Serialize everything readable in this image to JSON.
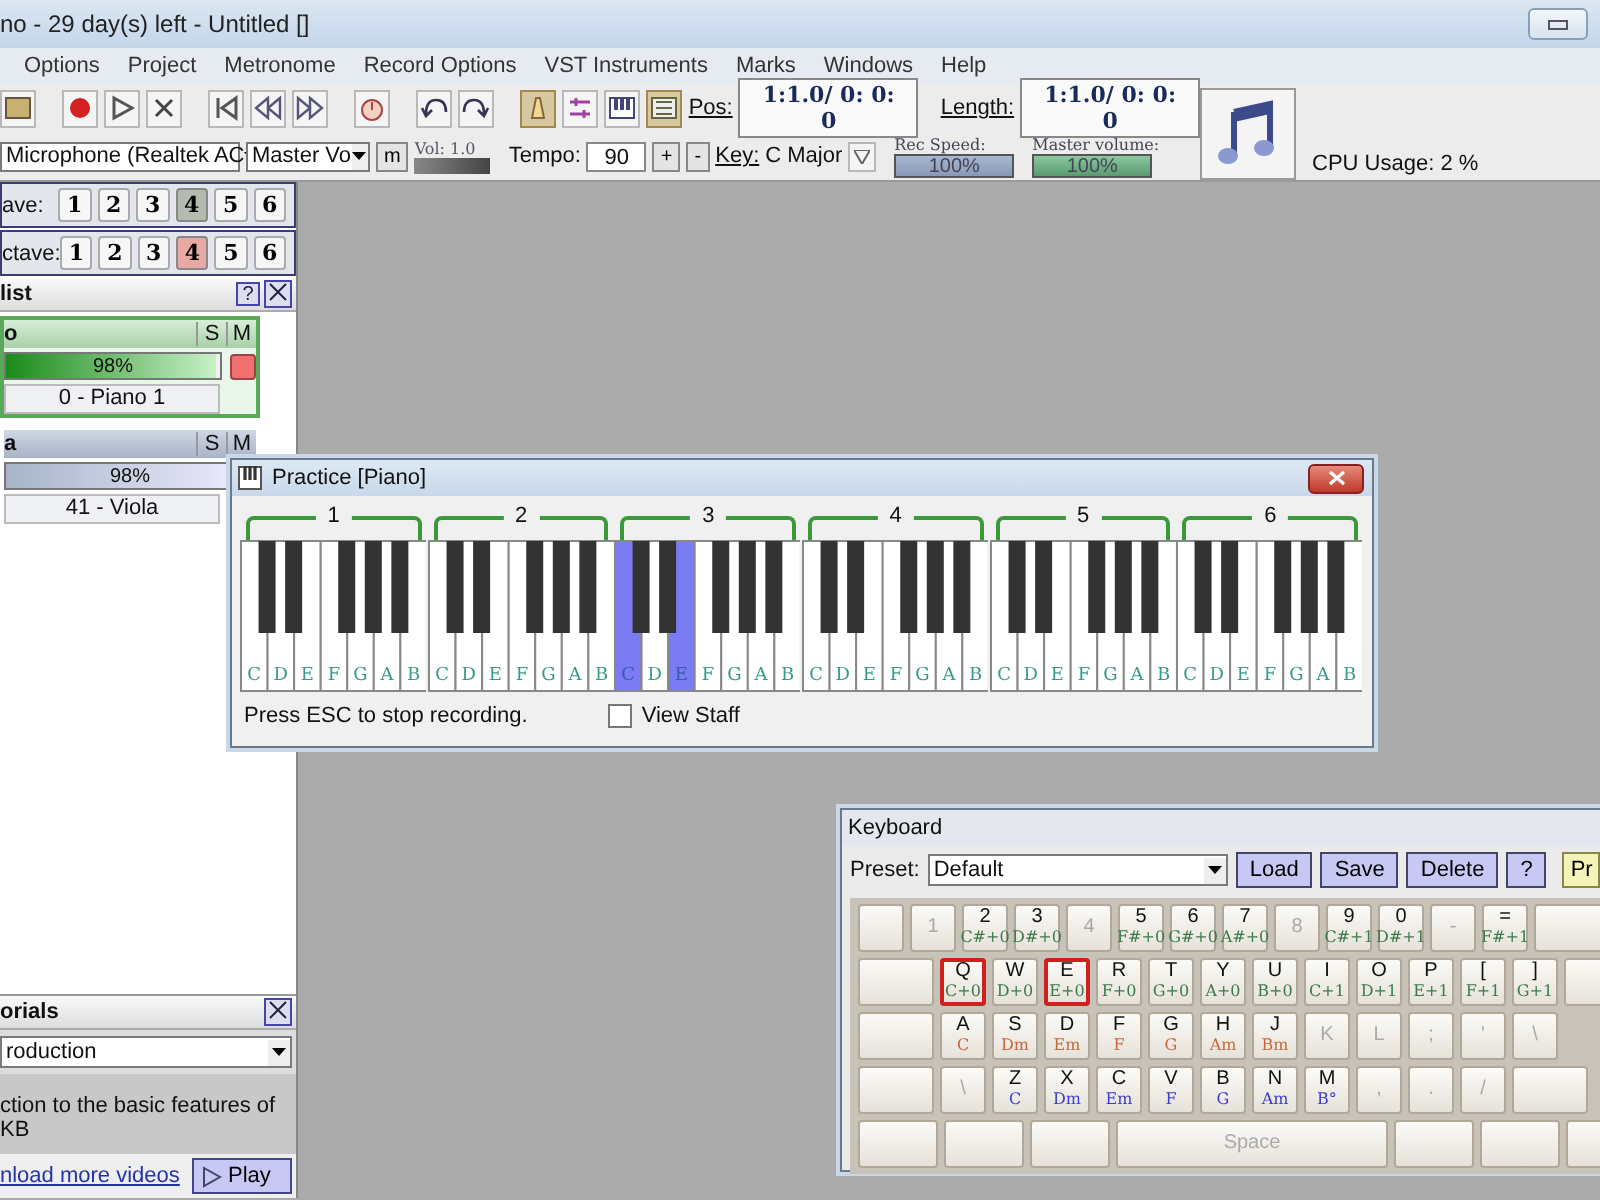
{
  "window": {
    "title": "no - 29 day(s) left - Untitled []"
  },
  "menu": [
    "Options",
    "Project",
    "Metronome",
    "Record Options",
    "VST Instruments",
    "Marks",
    "Windows",
    "Help"
  ],
  "transport": {
    "pos_label": "Pos:",
    "pos": "1:1.0/ 0: 0: 0",
    "length_label": "Length:",
    "length": "1:1.0/ 0: 0: 0"
  },
  "controls": {
    "input": "Microphone (Realtek AC",
    "output": "Master Vo",
    "mute": "m",
    "volume": {
      "label": "Vol: 1.0",
      "level": 1
    },
    "tempo_label": "Tempo:",
    "tempo": "90",
    "plus": "+",
    "minus": "-",
    "key_label": "Key:",
    "key": "C Major",
    "rec_speed_label": "Rec Speed:",
    "rec_speed": "100%",
    "master_label": "Master volume:",
    "master": "100%",
    "cpu": "CPU Usage: 2 %"
  },
  "octaves": [
    {
      "label": "ave:",
      "color": "#b4bcb0",
      "buttons": [
        {
          "label": "1",
          "selected": false
        },
        {
          "label": "2",
          "selected": false
        },
        {
          "label": "3",
          "selected": false
        },
        {
          "label": "4",
          "selected": true
        },
        {
          "label": "5",
          "selected": false
        },
        {
          "label": "6",
          "selected": false
        }
      ]
    },
    {
      "label": "ctave:",
      "color": "#e8a8a4",
      "buttons": [
        {
          "label": "1",
          "selected": false
        },
        {
          "label": "2",
          "selected": false
        },
        {
          "label": "3",
          "selected": false
        },
        {
          "label": "4",
          "selected": true
        },
        {
          "label": "5",
          "selected": false
        },
        {
          "label": "6",
          "selected": false
        }
      ]
    }
  ],
  "track_list": {
    "title": "list",
    "help": "?",
    "tracks": [
      {
        "name": "o",
        "solo": "S",
        "mute": "M",
        "level": 0.98,
        "reading": "98%",
        "instrument": "0 - Piano 1",
        "selected": true,
        "recording": true
      },
      {
        "name": "a",
        "solo": "S",
        "mute": "M",
        "level": 0.98,
        "reading": "98%",
        "instrument": "41 - Viola",
        "selected": false,
        "recording": false
      }
    ]
  },
  "tutorials": {
    "title": "orials",
    "video": "roduction",
    "description": "ction to the basic features of KB",
    "link": "nload more videos",
    "play": "Play"
  },
  "practice": {
    "title": "Practice [Piano]",
    "status": "Press ESC to stop recording.",
    "view_staff": {
      "label": "View Staff",
      "checked": false
    },
    "octaves": [
      {
        "label": "1",
        "keys": [
          {
            "note": "C",
            "pressed": false
          },
          {
            "note": "D",
            "pressed": false
          },
          {
            "note": "E",
            "pressed": false
          },
          {
            "note": "F",
            "pressed": false
          },
          {
            "note": "G",
            "pressed": false
          },
          {
            "note": "A",
            "pressed": false
          },
          {
            "note": "B",
            "pressed": false
          }
        ]
      },
      {
        "label": "2",
        "keys": [
          {
            "note": "C",
            "pressed": false
          },
          {
            "note": "D",
            "pressed": false
          },
          {
            "note": "E",
            "pressed": false
          },
          {
            "note": "F",
            "pressed": false
          },
          {
            "note": "G",
            "pressed": false
          },
          {
            "note": "A",
            "pressed": false
          },
          {
            "note": "B",
            "pressed": false
          }
        ]
      },
      {
        "label": "3",
        "keys": [
          {
            "note": "C",
            "pressed": true
          },
          {
            "note": "D",
            "pressed": false
          },
          {
            "note": "E",
            "pressed": true
          },
          {
            "note": "F",
            "pressed": false
          },
          {
            "note": "G",
            "pressed": false
          },
          {
            "note": "A",
            "pressed": false
          },
          {
            "note": "B",
            "pressed": false
          }
        ]
      },
      {
        "label": "4",
        "keys": [
          {
            "note": "C",
            "pressed": false
          },
          {
            "note": "D",
            "pressed": false
          },
          {
            "note": "E",
            "pressed": false
          },
          {
            "note": "F",
            "pressed": false
          },
          {
            "note": "G",
            "pressed": false
          },
          {
            "note": "A",
            "pressed": false
          },
          {
            "note": "B",
            "pressed": false
          }
        ]
      },
      {
        "label": "5",
        "keys": [
          {
            "note": "C",
            "pressed": false
          },
          {
            "note": "D",
            "pressed": false
          },
          {
            "note": "E",
            "pressed": false
          },
          {
            "note": "F",
            "pressed": false
          },
          {
            "note": "G",
            "pressed": false
          },
          {
            "note": "A",
            "pressed": false
          },
          {
            "note": "B",
            "pressed": false
          }
        ]
      },
      {
        "label": "6",
        "keys": [
          {
            "note": "C",
            "pressed": false
          },
          {
            "note": "D",
            "pressed": false
          },
          {
            "note": "E",
            "pressed": false
          },
          {
            "note": "F",
            "pressed": false
          },
          {
            "note": "G",
            "pressed": false
          },
          {
            "note": "A",
            "pressed": false
          },
          {
            "note": "B",
            "pressed": false
          }
        ]
      }
    ]
  },
  "keyboard": {
    "title": "Keyboard",
    "preset_label": "Preset:",
    "preset": "Default",
    "buttons": [
      "Load",
      "Save",
      "Delete",
      "?"
    ],
    "extra_button": "Pr",
    "rows": [
      {
        "color": "#3a7a4a",
        "keys": [
          {
            "kind": "blank",
            "pressed": false
          },
          {
            "kind": "key",
            "label": "1",
            "pressed": false
          },
          {
            "kind": "key",
            "label": "2",
            "note": "C#+0",
            "pressed": false
          },
          {
            "kind": "key",
            "label": "3",
            "note": "D#+0",
            "pressed": false
          },
          {
            "kind": "key",
            "label": "4",
            "pressed": false
          },
          {
            "kind": "key",
            "label": "5",
            "note": "F#+0",
            "pressed": false
          },
          {
            "kind": "key",
            "label": "6",
            "note": "G#+0",
            "pressed": false
          },
          {
            "kind": "key",
            "label": "7",
            "note": "A#+0",
            "pressed": false
          },
          {
            "kind": "key",
            "label": "8",
            "pressed": false
          },
          {
            "kind": "key",
            "label": "9",
            "note": "C#+1",
            "pressed": false
          },
          {
            "kind": "key",
            "label": "0",
            "note": "D#+1",
            "pressed": false
          },
          {
            "kind": "key",
            "label": "-",
            "pressed": false
          },
          {
            "kind": "key",
            "label": "=",
            "note": "F#+1",
            "pressed": false
          },
          {
            "kind": "wide",
            "pressed": false
          }
        ]
      },
      {
        "color": "#3a7a4a",
        "keys": [
          {
            "kind": "wide",
            "pressed": false
          },
          {
            "kind": "key",
            "label": "Q",
            "note": "C+0",
            "pressed": true
          },
          {
            "kind": "key",
            "label": "W",
            "note": "D+0",
            "pressed": false
          },
          {
            "kind": "key",
            "label": "E",
            "note": "E+0",
            "pressed": true
          },
          {
            "kind": "key",
            "label": "R",
            "note": "F+0",
            "pressed": false
          },
          {
            "kind": "key",
            "label": "T",
            "note": "G+0",
            "pressed": false
          },
          {
            "kind": "key",
            "label": "Y",
            "note": "A+0",
            "pressed": false
          },
          {
            "kind": "key",
            "label": "U",
            "note": "B+0",
            "pressed": false
          },
          {
            "kind": "key",
            "label": "I",
            "note": "C+1",
            "pressed": false
          },
          {
            "kind": "key",
            "label": "O",
            "note": "D+1",
            "pressed": false
          },
          {
            "kind": "key",
            "label": "P",
            "note": "E+1",
            "pressed": false
          },
          {
            "kind": "key",
            "label": "[",
            "note": "F+1",
            "pressed": false
          },
          {
            "kind": "key",
            "label": "]",
            "note": "G+1",
            "pressed": false
          },
          {
            "kind": "wide",
            "pressed": false
          }
        ]
      },
      {
        "color": "#c8683a",
        "keys": [
          {
            "kind": "wide",
            "pressed": false
          },
          {
            "kind": "key",
            "label": "A",
            "note": "C",
            "pressed": false
          },
          {
            "kind": "key",
            "label": "S",
            "note": "Dm",
            "pressed": false
          },
          {
            "kind": "key",
            "label": "D",
            "note": "Em",
            "pressed": false
          },
          {
            "kind": "key",
            "label": "F",
            "note": "F",
            "pressed": false
          },
          {
            "kind": "key",
            "label": "G",
            "note": "G",
            "pressed": false
          },
          {
            "kind": "key",
            "label": "H",
            "note": "Am",
            "pressed": false
          },
          {
            "kind": "key",
            "label": "J",
            "note": "Bm",
            "pressed": false
          },
          {
            "kind": "key",
            "label": "K",
            "pressed": false
          },
          {
            "kind": "key",
            "label": "L",
            "pressed": false
          },
          {
            "kind": "key",
            "label": ";",
            "pressed": false
          },
          {
            "kind": "key",
            "label": "'",
            "pressed": false
          },
          {
            "kind": "key",
            "label": "\\",
            "pressed": false
          }
        ]
      },
      {
        "color": "#3a3ad0",
        "keys": [
          {
            "kind": "wide",
            "pressed": false
          },
          {
            "kind": "key",
            "label": "\\",
            "pressed": false
          },
          {
            "kind": "key",
            "label": "Z",
            "note": "C",
            "pressed": false
          },
          {
            "kind": "key",
            "label": "X",
            "note": "Dm",
            "pressed": false
          },
          {
            "kind": "key",
            "label": "C",
            "note": "Em",
            "pressed": false
          },
          {
            "kind": "key",
            "label": "V",
            "note": "F",
            "pressed": false
          },
          {
            "kind": "key",
            "label": "B",
            "note": "G",
            "pressed": false
          },
          {
            "kind": "key",
            "label": "N",
            "note": "Am",
            "pressed": false
          },
          {
            "kind": "key",
            "label": "M",
            "note": "B°",
            "pressed": false
          },
          {
            "kind": "key",
            "label": ",",
            "pressed": false
          },
          {
            "kind": "key",
            "label": ".",
            "pressed": false
          },
          {
            "kind": "key",
            "label": "/",
            "pressed": false
          },
          {
            "kind": "wide",
            "pressed": false
          }
        ]
      },
      {
        "keys": [
          {
            "kind": "mod",
            "pressed": false
          },
          {
            "kind": "mod",
            "pressed": false
          },
          {
            "kind": "mod",
            "pressed": false
          },
          {
            "kind": "space",
            "label": "Space",
            "pressed": false
          },
          {
            "kind": "mod",
            "pressed": false
          },
          {
            "kind": "mod",
            "pressed": false
          },
          {
            "kind": "mod",
            "pressed": false
          }
        ]
      }
    ]
  }
}
